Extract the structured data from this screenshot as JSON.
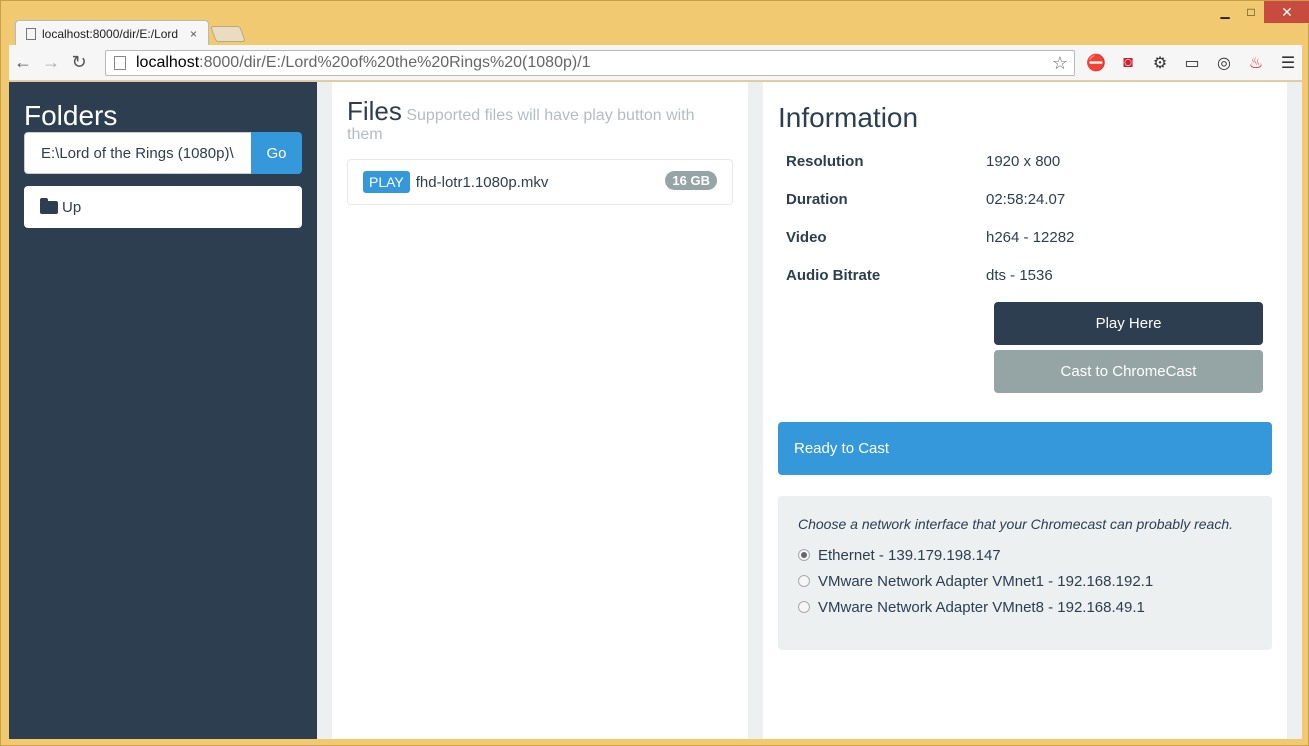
{
  "browser": {
    "tab_title": "localhost:8000/dir/E:/Lord",
    "tab_close": "×",
    "window_minimize": "▁",
    "window_maximize": "□",
    "window_close": "✕",
    "back": "←",
    "forward": "→",
    "reload": "↻",
    "url_host": "localhost",
    "url_path": ":8000/dir/E:/Lord%20of%20the%20Rings%20(1080p)/1",
    "star": "☆",
    "extensions": [
      "stop-icon",
      "pocket-icon",
      "gear-icon",
      "cast-icon",
      "film-reel-icon",
      "fire-icon",
      "menu-icon"
    ]
  },
  "sidebar": {
    "title": "Folders",
    "folder_value": "E:\\Lord of the Rings (1080p)\\",
    "go_label": "Go",
    "up_label": "Up"
  },
  "files": {
    "title": "Files",
    "subtitle": "Supported files will have play button with them",
    "items": [
      {
        "play_label": "PLAY",
        "name": "fhd-lotr1.1080p.mkv",
        "size": "16 GB"
      }
    ]
  },
  "info": {
    "title": "Information",
    "rows": [
      {
        "key": "Resolution",
        "value": "1920 x 800"
      },
      {
        "key": "Duration",
        "value": "02:58:24.07"
      },
      {
        "key": "Video",
        "value": "h264 - 12282"
      },
      {
        "key": "Audio Bitrate",
        "value": "dts - 1536"
      }
    ],
    "play_here_label": "Play Here",
    "cast_label": "Cast to ChromeCast",
    "status": "Ready to Cast",
    "network_hint": "Choose a network interface that your Chromecast can probably reach.",
    "interfaces": [
      {
        "label": "Ethernet - 139.179.198.147",
        "selected": true
      },
      {
        "label": "VMware Network Adapter VMnet1 - 192.168.192.1",
        "selected": false
      },
      {
        "label": "VMware Network Adapter VMnet8 - 192.168.49.1",
        "selected": false
      }
    ]
  },
  "colors": {
    "sidebar_bg": "#2c3e50",
    "accent": "#3498db",
    "muted": "#95a5a6",
    "window_frame": "#f1c970"
  }
}
